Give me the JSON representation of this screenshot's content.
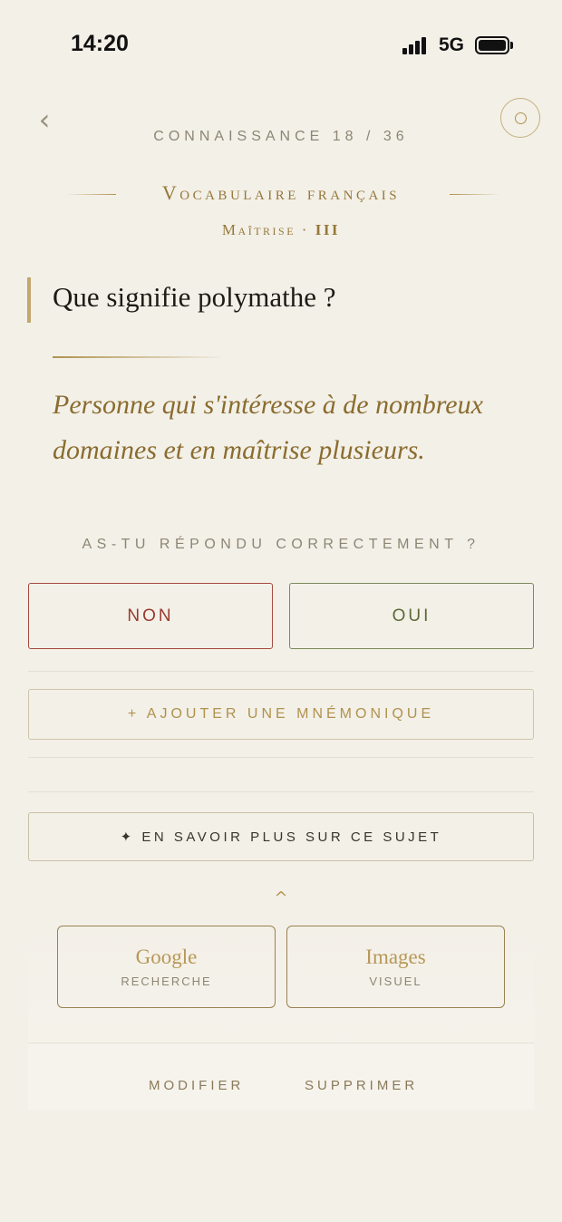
{
  "status_bar": {
    "time": "14:20",
    "network": "5G"
  },
  "nav": {
    "back_icon": "‹",
    "progress": "CONNAISSANCE 18 / 36"
  },
  "deck": {
    "title": "Vocabulaire français",
    "level_label": "Maîtrise ·",
    "level_value": "III"
  },
  "card": {
    "question": "Que signifie polymathe ?",
    "answer": "Personne qui s'intéresse à de nombreux domaines et en maîtrise plusieurs."
  },
  "assessment": {
    "prompt": "AS-TU RÉPONDU CORRECTEMENT ?",
    "no_label": "NON",
    "yes_label": "OUI"
  },
  "actions": {
    "mnemonic_label": "+ AJOUTER UNE MNÉMONIQUE",
    "learn_more_label": "✦ EN SAVOIR PLUS SUR CE SUJET",
    "collapse_icon": "^"
  },
  "sources": [
    {
      "name": "Google",
      "sub": "RECHERCHE"
    },
    {
      "name": "Images",
      "sub": "VISUEL"
    }
  ],
  "footer": {
    "edit_label": "MODIFIER",
    "delete_label": "SUPPRIMER"
  },
  "colors": {
    "background": "#f3f0e8",
    "gold": "#b0924e",
    "no": "#a44a3e",
    "yes": "#7d8a5a"
  }
}
